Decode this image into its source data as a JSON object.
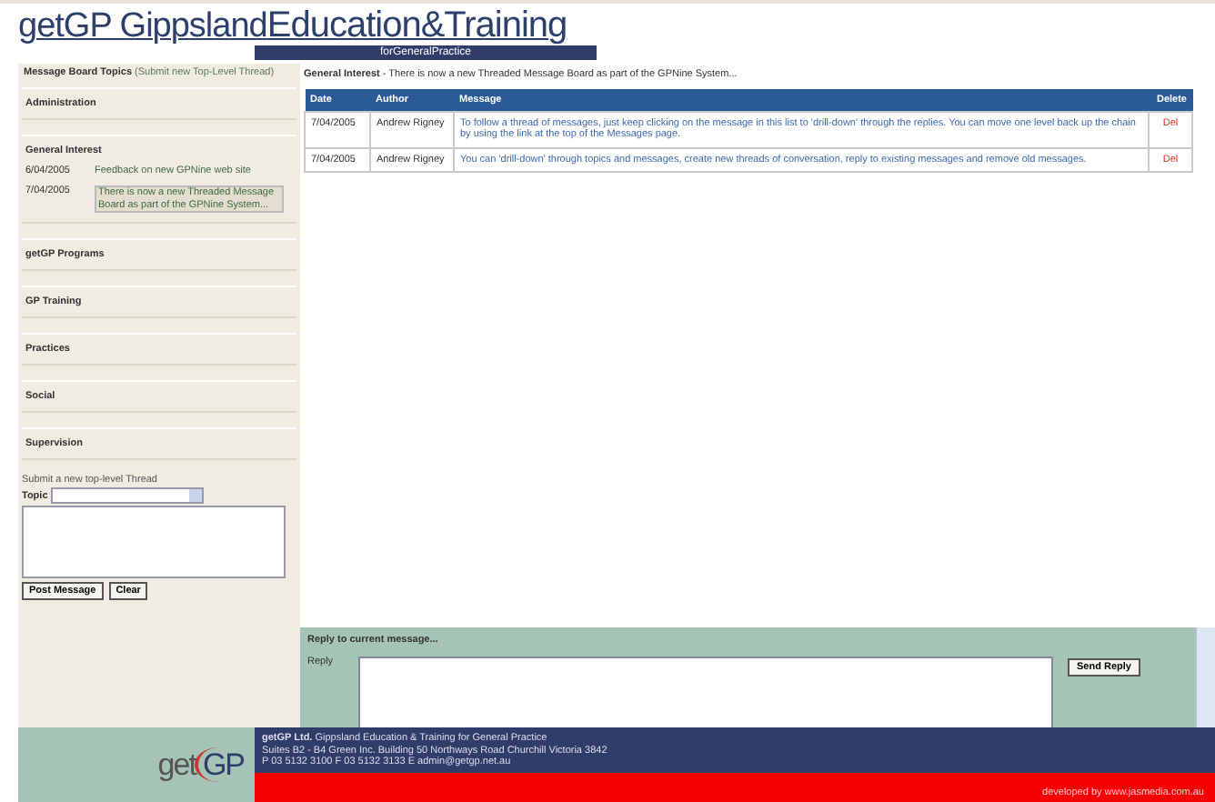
{
  "header": {
    "brand_prefix": "getGP Gippsland",
    "brand_main": "Education&Training",
    "tagline": "forGeneralPractice"
  },
  "sidebar": {
    "heading": "Message Board Topics",
    "submit_link": "(Submit new Top-Level Thread)",
    "topics": [
      {
        "name": "Administration"
      },
      {
        "name": "General Interest",
        "threads": [
          {
            "date": "6/04/2005",
            "title": "Feedback on new GPNine web site",
            "selected": false
          },
          {
            "date": "7/04/2005",
            "title": "There is now a new Threaded Message Board as part of the GPNine System...",
            "selected": true
          }
        ]
      },
      {
        "name": "getGP Programs"
      },
      {
        "name": "GP Training"
      },
      {
        "name": "Practices"
      },
      {
        "name": "Social"
      },
      {
        "name": "Supervision"
      }
    ],
    "new_thread": {
      "label": "Submit a new top-level Thread",
      "topic_label": "Topic",
      "buttons": [
        "Post Message",
        "Clear"
      ]
    }
  },
  "main": {
    "topic": "General Interest",
    "subject": " - There is now a new Threaded Message Board as part of the GPNine System...",
    "table": {
      "columns": [
        "Date",
        "Author",
        "Message",
        "Delete"
      ],
      "rows": [
        {
          "date": "7/04/2005",
          "author": "Andrew Rigney",
          "message": "To follow a thread of messages, just keep clicking on the message in this list to 'drill-down' through the replies. You can move one level back up the chain by using the link at the top of the Messages page.",
          "delete": "Del"
        },
        {
          "date": "7/04/2005",
          "author": "Andrew Rigney",
          "message": "You can 'drill-down' through topics and messages, create new threads of conversation, reply to existing messages and remove old messages.",
          "delete": "Del"
        }
      ]
    },
    "reply": {
      "heading": "Reply to current message...",
      "label": "Reply",
      "button": "Send Reply"
    }
  },
  "footer": {
    "logo_left": "get",
    "logo_right": "GP",
    "company": "getGP Ltd.",
    "company_desc": " Gippsland Education & Training for General Practice",
    "address": "Suites B2 - B4 Green Inc. Building 50 Northways Road Churchill Victoria 3842",
    "contact": "P 03 5132 3100 F 03 5132 3133 E admin@getgp.net.au",
    "credit": "developed by www.jasmedia.com.au"
  }
}
